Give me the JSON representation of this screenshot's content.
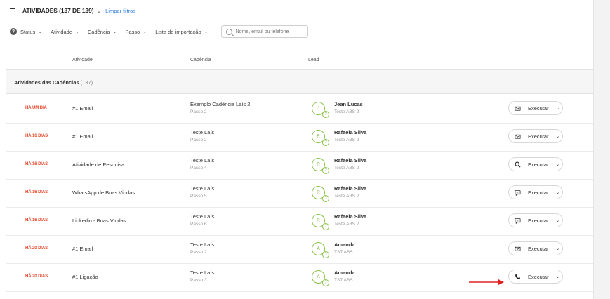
{
  "header": {
    "title": "ATIVIDADES (137 DE 139)",
    "clear_filters": "Limpar filtros"
  },
  "filters": {
    "status": "Status",
    "atividade": "Atividade",
    "cadencia": "Cadência",
    "passo": "Passo",
    "lista": "Lista de importação",
    "search_placeholder": "Nome, email ou telefone"
  },
  "columns": {
    "atividade": "Atividade",
    "cadencia": "Cadência",
    "lead": "Lead"
  },
  "group": {
    "label": "Atividades das Cadências",
    "count": "(137)"
  },
  "rows": [
    {
      "badge": "HÁ UM DIA",
      "activity": "#1 Email",
      "cadence": "Exemplo Cadência Laís 2",
      "step": "Passo 2",
      "initial": "J",
      "lead": "Jean Lucas",
      "org": "Teste ABS 2",
      "action_icon": "mail-icon",
      "action": "Executar"
    },
    {
      "badge": "HÁ 16 DIAS",
      "activity": "#1 Email",
      "cadence": "Teste Laís",
      "step": "Passo 2",
      "initial": "R",
      "lead": "Rafaela Silva",
      "org": "Teste ABS 2",
      "action_icon": "mail-icon",
      "action": "Executar"
    },
    {
      "badge": "HÁ 16 DIAS",
      "activity": "Atividade de Pesquisa",
      "cadence": "Teste Laís",
      "step": "Passo 4",
      "initial": "R",
      "lead": "Rafaela Silva",
      "org": "Teste ABS 2",
      "action_icon": "search-icon",
      "action": "Executar"
    },
    {
      "badge": "HÁ 16 DIAS",
      "activity": "WhatsApp de Boas Vindas",
      "cadence": "Teste Laís",
      "step": "Passo 5",
      "initial": "R",
      "lead": "Rafaela Silva",
      "org": "Teste ABS 2",
      "action_icon": "chat-icon",
      "action": "Executar"
    },
    {
      "badge": "HÁ 16 DIAS",
      "activity": "Linkedin - Boas Vindas",
      "cadence": "Teste Laís",
      "step": "Passo 6",
      "initial": "R",
      "lead": "Rafaela Silva",
      "org": "Teste ABS 2",
      "action_icon": "chat-icon",
      "action": "Executar"
    },
    {
      "badge": "HÁ 20 DIAS",
      "activity": "#1 Email",
      "cadence": "Teste Laís",
      "step": "Passo 2",
      "initial": "A",
      "lead": "Amanda",
      "org": "TST ABS",
      "action_icon": "mail-icon",
      "action": "Executar"
    },
    {
      "badge": "HÁ 20 DIAS",
      "activity": "#1 Ligação",
      "cadence": "Teste Laís",
      "step": "Passo 3",
      "initial": "A",
      "lead": "Amanda",
      "org": "TST ABS",
      "action_icon": "phone-icon",
      "action": "Executar"
    }
  ],
  "accent_color": "#e8482d",
  "link_color": "#2a7be0",
  "avatar_color": "#8bc34a",
  "annotation_arrow_color": "#e02020"
}
